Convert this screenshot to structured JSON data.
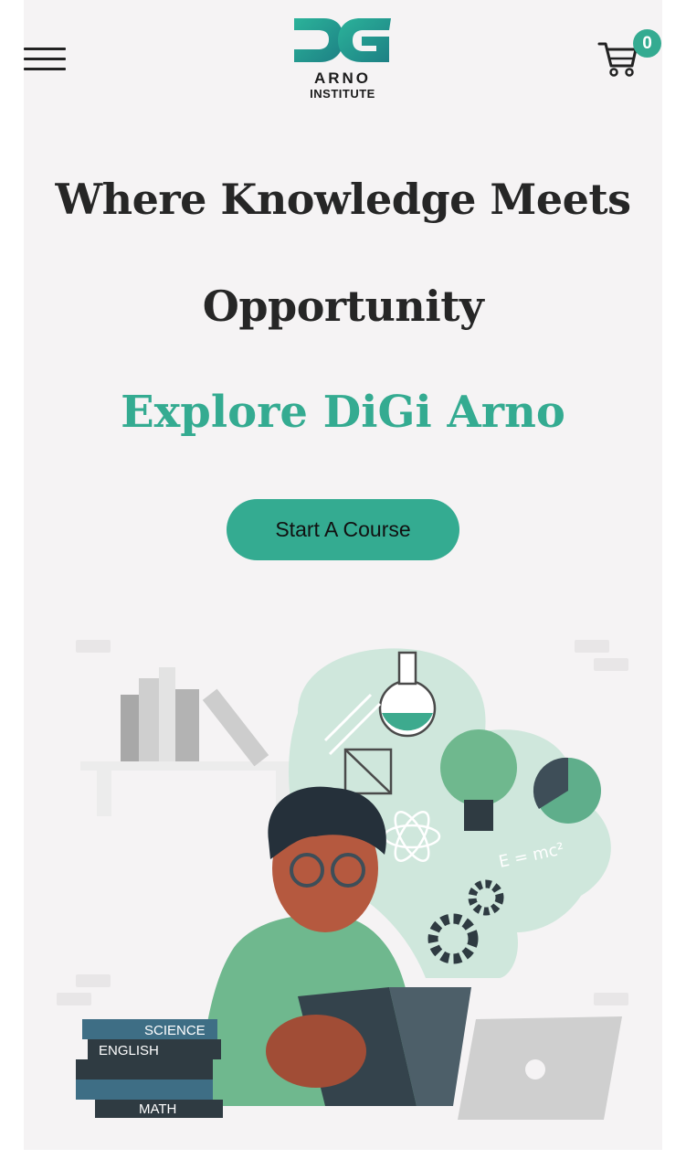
{
  "header": {
    "menu_icon": "hamburger-menu-icon",
    "logo": {
      "monogram": "DG",
      "name": "ARNO",
      "subtitle": "INSTITUTE",
      "accent_color": "#34ab91"
    },
    "cart": {
      "icon": "shopping-cart-icon",
      "count": "0"
    }
  },
  "hero": {
    "title": "Where Knowledge Meets Opportunity",
    "subtitle": "Explore DiGi Arno",
    "cta_label": "Start A Course"
  },
  "illustration": {
    "book_labels": [
      "SCIENCE",
      "ENGLISH",
      "MATH"
    ],
    "formula": "E = mc²"
  },
  "colors": {
    "accent": "#34ab91",
    "background": "#f5f3f4",
    "text": "#262626"
  }
}
